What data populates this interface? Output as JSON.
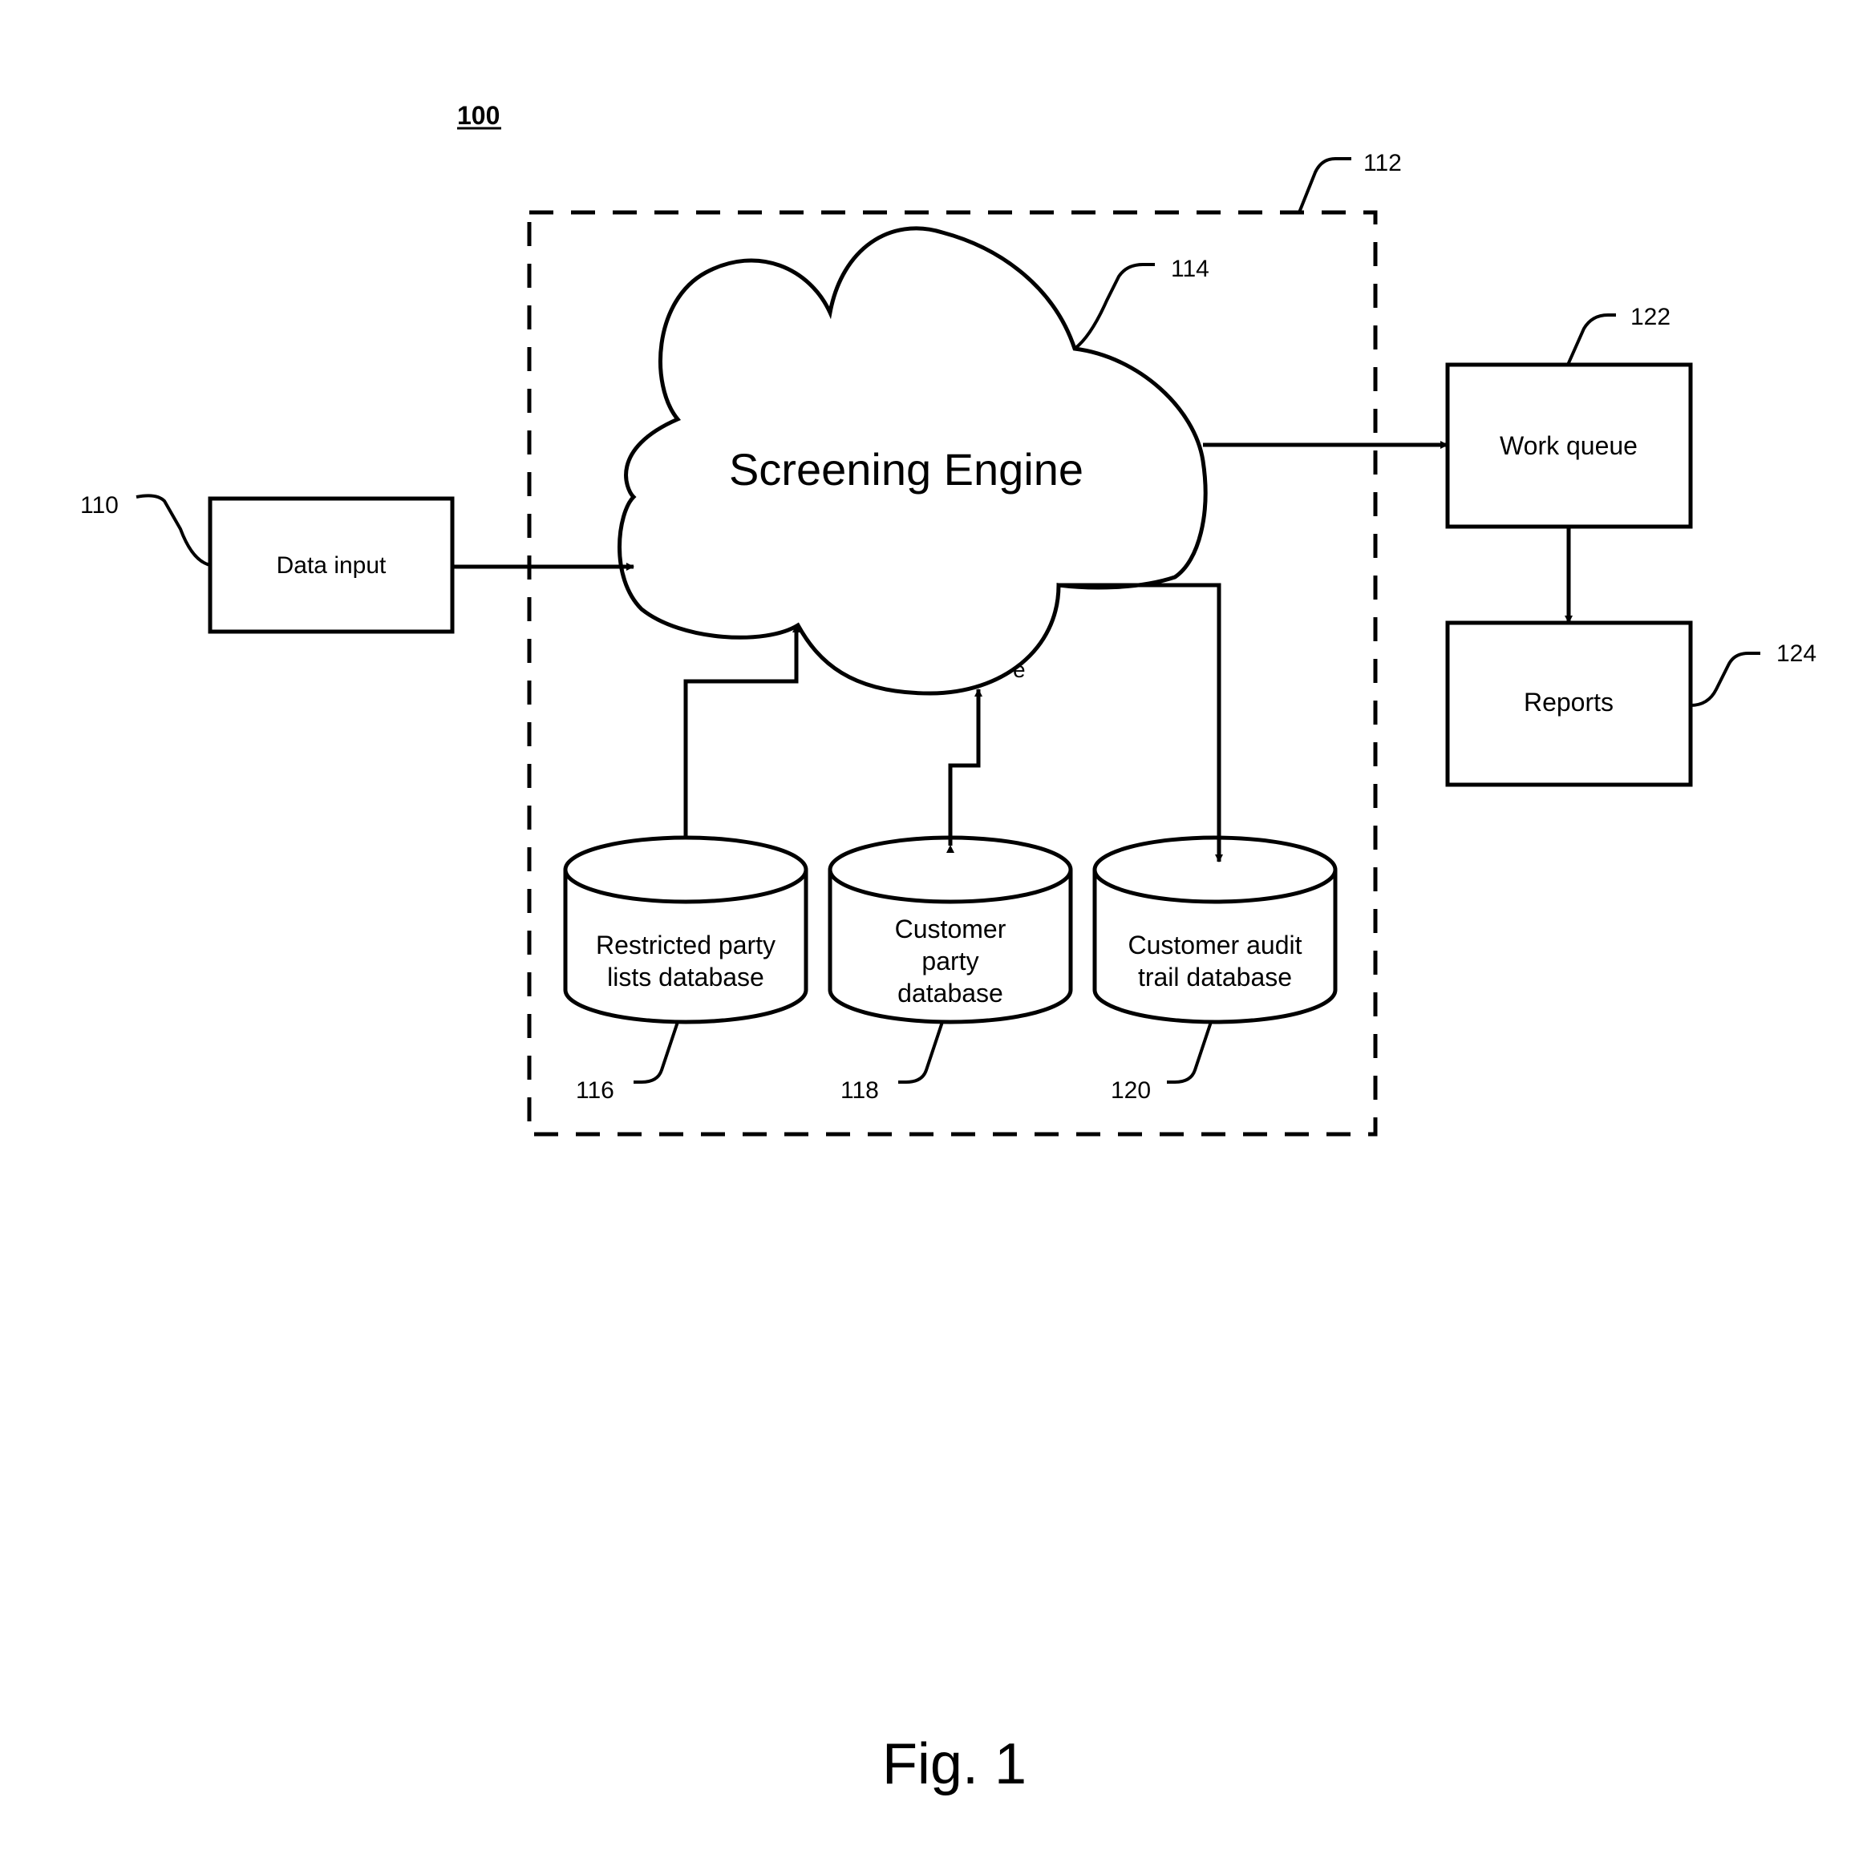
{
  "figure": {
    "number_label": "100",
    "caption": "Fig. 1"
  },
  "system_boundary": {
    "ref": "112"
  },
  "engine": {
    "label": "Screening Engine",
    "ref": "114",
    "stray_glyph": "e"
  },
  "data_input": {
    "label": "Data input",
    "ref": "110"
  },
  "work_queue": {
    "label": "Work queue",
    "ref": "122"
  },
  "reports": {
    "label": "Reports",
    "ref": "124"
  },
  "databases": [
    {
      "lines": [
        "Restricted party",
        "lists database"
      ],
      "ref": "116"
    },
    {
      "lines": [
        "Customer",
        "party",
        "database"
      ],
      "ref": "118"
    },
    {
      "lines": [
        "Customer audit",
        "trail database"
      ],
      "ref": "120"
    }
  ],
  "connections": [
    {
      "from": "Data input",
      "to": "Screening Engine",
      "direction": "one-way"
    },
    {
      "from": "Screening Engine",
      "to": "Work queue",
      "direction": "one-way"
    },
    {
      "from": "Work queue",
      "to": "Reports",
      "direction": "one-way"
    },
    {
      "from": "Restricted party lists database",
      "to": "Screening Engine",
      "direction": "one-way"
    },
    {
      "from": "Customer party database",
      "to": "Screening Engine",
      "direction": "two-way"
    },
    {
      "from": "Screening Engine",
      "to": "Customer audit trail database",
      "direction": "one-way"
    }
  ]
}
